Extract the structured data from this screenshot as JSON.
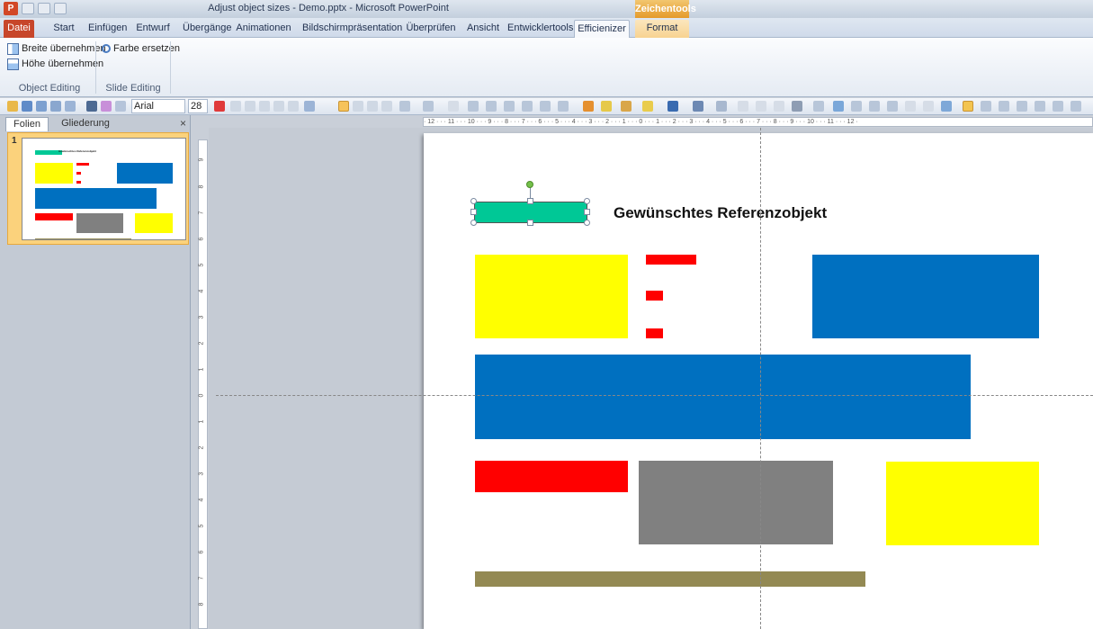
{
  "window": {
    "title": "Adjust object sizes - Demo.pptx - Microsoft PowerPoint",
    "contextual_header": "Zeichentools",
    "app_icon": "P"
  },
  "tabs": [
    "Datei",
    "Start",
    "Einfügen",
    "Entwurf",
    "Übergänge",
    "Animationen",
    "Bildschirmpräsentation",
    "Überprüfen",
    "Ansicht",
    "Entwicklertools",
    "Efficienizer",
    "Format"
  ],
  "active_tab": "Efficienizer",
  "ribbon": {
    "breite": "Breite übernehmen",
    "hoehe": "Höhe übernehmen",
    "farbe": "Farbe ersetzen",
    "group1": "Object Editing",
    "group2": "Slide Editing"
  },
  "format_toolbar": {
    "font": "Arial",
    "size": "28"
  },
  "panel": {
    "tab_slides": "Folien",
    "tab_outline": "Gliederung",
    "close": "×",
    "slide_number": "1"
  },
  "ruler": {
    "horizontal": "· 12 · · · 11 · · · 10 · · · 9 · · · 8 · · · 7 · · · 6 · · · 5 · · · 4 · · · 3 · · · 2 · · · 1 · · · 0 · · · 1 · · · 2 · · · 3 · · · 4 · · · 5 · · · 6 · · · 7 · · · 8 · · · 9 · · · 10 · · · 11 · · · 12 ·",
    "vertical": [
      "9",
      "8",
      "7",
      "6",
      "5",
      "4",
      "3",
      "2",
      "1",
      "0",
      "1",
      "2",
      "3",
      "4",
      "5",
      "6",
      "7",
      "8"
    ]
  },
  "slide": {
    "title": "Gewünschtes Referenzobjekt"
  },
  "colors": {
    "teal": "#00c896",
    "yellow": "#ffff00",
    "red": "#ff0000",
    "blue": "#0070c0",
    "gray": "#808080",
    "olive": "#938953"
  }
}
